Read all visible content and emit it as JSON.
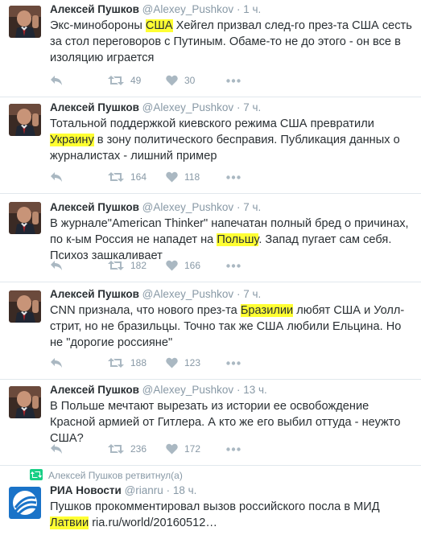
{
  "colors": {
    "highlight": "#ffff33",
    "muted": "#8899a6",
    "text": "#292f33",
    "retweet_green": "#19cf86"
  },
  "tweets": [
    {
      "name": "Алексей Пушков",
      "handle": "@Alexey_Pushkov",
      "dot": "·",
      "time": "1 ч.",
      "text": {
        "a": "Экс-минобороны ",
        "hl": "США",
        "b": " Хейгел призвал след-го през-та США сесть за стол переговоров с Путиным. Обаме-то не до этого - он все в изоляцию играется"
      },
      "retweets": "49",
      "likes": "30"
    },
    {
      "name": "Алексей Пушков",
      "handle": "@Alexey_Pushkov",
      "dot": "·",
      "time": "7 ч.",
      "text": {
        "a": "Тотальной поддержкой киевского режима США превратили ",
        "hl": "Украину",
        "b": " в зону политического бесправия. Публикация данных о журналистах - лишний пример"
      },
      "retweets": "164",
      "likes": "118"
    },
    {
      "name": "Алексей Пушков",
      "handle": "@Alexey_Pushkov",
      "dot": "·",
      "time": "7 ч.",
      "text": {
        "a": "В журнале\"American Thinker\" напечатан полный бред о причинах, по к-ым Россия не нападет на ",
        "hl": "Польшу",
        "b": ". Запад пугает сам себя. Психоз зашкаливает"
      },
      "retweets": "182",
      "likes": "166"
    },
    {
      "name": "Алексей Пушков",
      "handle": "@Alexey_Pushkov",
      "dot": "·",
      "time": "7 ч.",
      "text": {
        "a": "CNN признала, что нового през-та ",
        "hl": "Бразилии",
        "b": " любят США и Уолл-стрит, но не бразильцы. Точно так же США любили Ельцина. Но не \"дорогие россияне\""
      },
      "retweets": "188",
      "likes": "123"
    },
    {
      "name": "Алексей Пушков",
      "handle": "@Alexey_Pushkov",
      "dot": "·",
      "time": "13 ч.",
      "text": {
        "a": "В Польше мечтают вырезать из истории ее освобождение Красной армией от Гитлера. А кто же его выбил оттуда - неужто США?",
        "hl": "",
        "b": ""
      },
      "retweets": "236",
      "likes": "172"
    }
  ],
  "retweet_context": "Алексей Пушков ретвитнул(а)",
  "retweeted": {
    "name": "РИА Новости",
    "handle": "@rianru",
    "dot": "·",
    "time": "18 ч.",
    "text_a": "Пушков прокомментировал вызов российского посла в МИД ",
    "hl": "Латвии",
    "text_b": " ",
    "link": "ria.ru/world/20160512…"
  },
  "icons": {
    "reply": "reply-icon",
    "retweet": "retweet-icon",
    "like": "heart-icon",
    "more": "more-icon",
    "avatar": "avatar-photo",
    "ria_logo": "ria-novosti-logo"
  }
}
